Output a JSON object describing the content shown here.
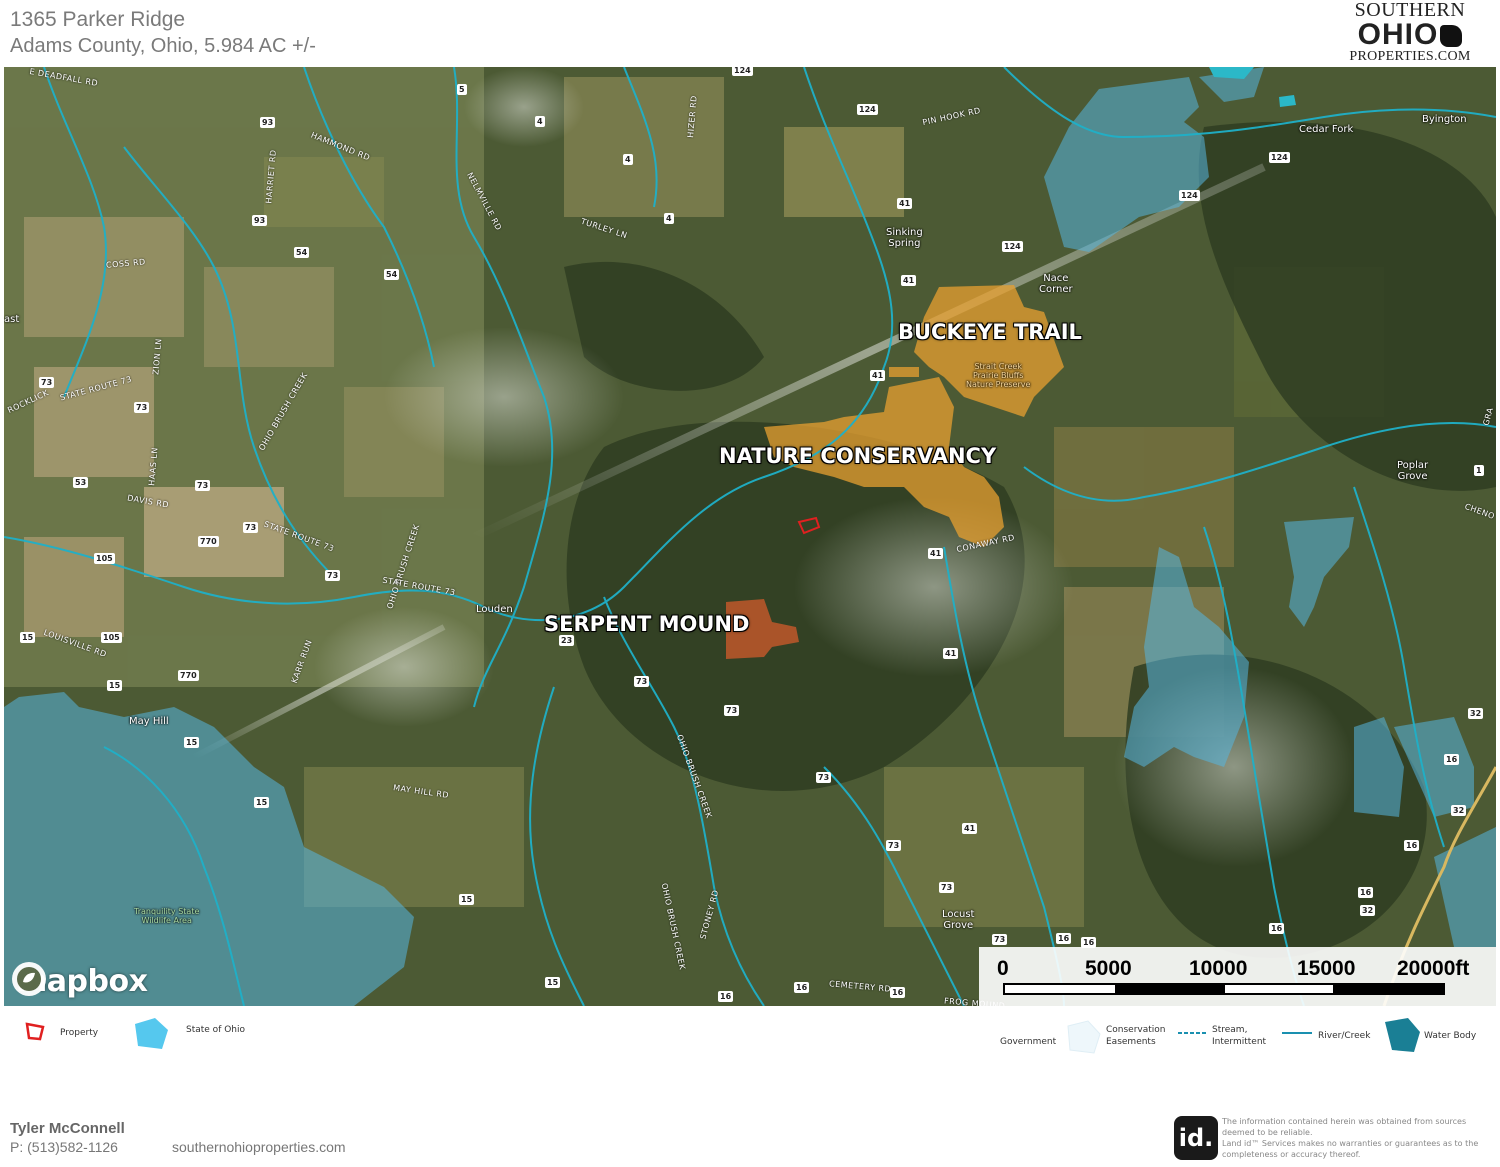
{
  "header": {
    "title": "1365 Parker Ridge",
    "subtitle": "Adams County, Ohio, 5.984 AC +/-"
  },
  "logo": {
    "line1": "SOUTHERN",
    "line2": "OHIO",
    "line3": "PROPERTIES.COM"
  },
  "map": {
    "attribution": "mapbox",
    "feature_labels": {
      "buckeye_trail": "BUCKEYE TRAIL",
      "nature_conservancy": "NATURE CONSERVANCY",
      "serpent_mound": "SERPENT MOUND"
    },
    "places": {
      "cedar_fork": "Cedar Fork",
      "byington": "Byington",
      "sinking_spring": "Sinking\nSpring",
      "nace_corner": "Nace\nCorner",
      "poplar_grove": "Poplar\nGrove",
      "louden": "Louden",
      "may_hill": "May Hill",
      "locust_grove": "Locust\nGrove",
      "east": "ast",
      "tranquility": "Tranquility State\nWildlife Area",
      "preserve": "Strait Creek\nPrairie Bluffs\nNature Preserve"
    },
    "roads": {
      "deadfall": "E DEADFALL RD",
      "hammond": "HAMMOND RD",
      "harriet": "HARRIET RD",
      "coss": "COSS RD",
      "nelmville": "NELMVILLE RD",
      "turley": "TURLEY LN",
      "hizer": "HIZER RD",
      "pin_hook": "PIN HOOK RD",
      "zion": "ZION LN",
      "rockl": "ROCKLICK",
      "sr73a": "STATE ROUTE 73",
      "ohio_brush_1": "OHIO BRUSH CREEK",
      "haas": "HAAS LN",
      "davis": "DAVIS RD",
      "sr73b": "STATE ROUTE 73",
      "ohio_brush_2": "OHIO BRUSH CREEK",
      "sr73c": "STATE ROUTE 73",
      "louisville": "LOUISVILLE RD",
      "karr": "KARR RUN",
      "conaway": "CONAWAY RD",
      "may_hill_rd": "MAY HILL RD",
      "ohio_brush_3": "OHIO BRUSH CREEK",
      "ohio_brush_4": "OHIO BRUSH CREEK",
      "stoney": "STONEY RD",
      "cemetery": "CEMETERY RD",
      "frog": "FROG MOUND",
      "chenow": "CHENO",
      "gra": "GRA"
    },
    "route_shields": [
      "124",
      "5",
      "4",
      "4",
      "4",
      "93",
      "93",
      "54",
      "54",
      "124",
      "124",
      "124",
      "124",
      "41",
      "41",
      "41",
      "73",
      "73",
      "73",
      "53",
      "73",
      "770",
      "73",
      "105",
      "15",
      "105",
      "15",
      "770",
      "15",
      "15",
      "23",
      "73",
      "73",
      "73",
      "73",
      "73",
      "73",
      "41",
      "41",
      "41",
      "16",
      "16",
      "16",
      "16",
      "32",
      "32",
      "32",
      "16",
      "16",
      "16",
      "16",
      "16",
      "15",
      "15",
      "1"
    ],
    "scale": {
      "labels": [
        "0",
        "5000",
        "10000",
        "15000",
        "20000ft"
      ]
    },
    "colors": {
      "state_of_ohio": "#55b7e0",
      "conservation": "#e8a030",
      "serpent": "#c0582a",
      "river": "#1fb0c8",
      "property": "#e02020"
    }
  },
  "legend": {
    "property": "Property",
    "state_of_ohio": "State of Ohio",
    "government": "Government",
    "conservation": "Conservation\nEasements",
    "stream": "Stream,\nIntermittent",
    "river": "River/Creek",
    "water_body": "Water Body"
  },
  "footer": {
    "agent": "Tyler McConnell",
    "phone": "P: (513)582-1126",
    "website": "southernohioproperties.com",
    "id_logo": "id.",
    "disclaimer": "The information contained herein was obtained from sources deemed to be reliable.\nLand id™ Services makes no warranties or guarantees as to the completeness or accuracy thereof."
  }
}
